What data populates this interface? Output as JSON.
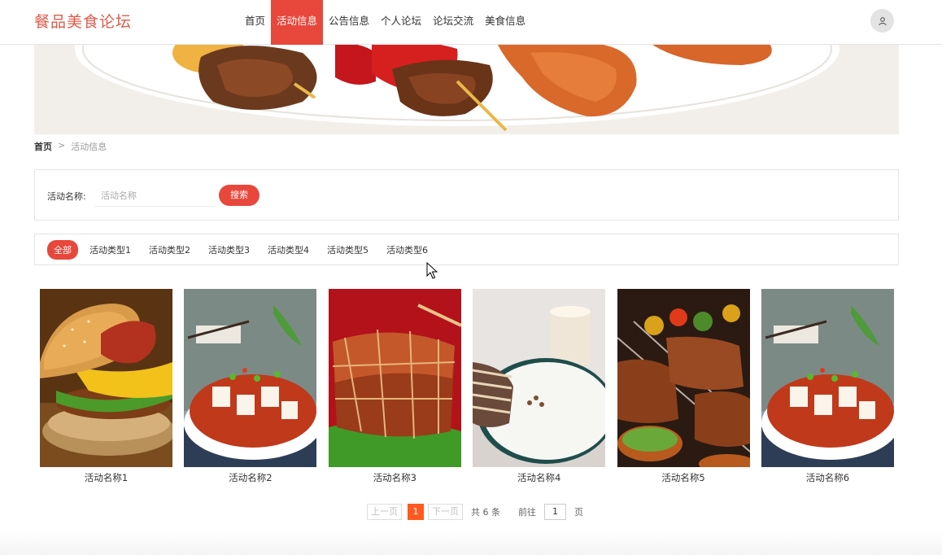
{
  "header": {
    "logo": "餐品美食论坛",
    "nav": [
      {
        "label": "首页",
        "active": false
      },
      {
        "label": "活动信息",
        "active": true
      },
      {
        "label": "公告信息",
        "active": false
      },
      {
        "label": "个人论坛",
        "active": false
      },
      {
        "label": "论坛交流",
        "active": false
      },
      {
        "label": "美食信息",
        "active": false
      }
    ],
    "avatar_icon": "user-icon"
  },
  "breadcrumb": {
    "home": "首页",
    "separator": ">",
    "current": "活动信息"
  },
  "search": {
    "label": "活动名称:",
    "placeholder": "活动名称",
    "value": "",
    "button": "搜索"
  },
  "categories": [
    {
      "label": "全部",
      "active": true
    },
    {
      "label": "活动类型1",
      "active": false
    },
    {
      "label": "活动类型2",
      "active": false
    },
    {
      "label": "活动类型3",
      "active": false
    },
    {
      "label": "活动类型4",
      "active": false
    },
    {
      "label": "活动类型5",
      "active": false
    },
    {
      "label": "活动类型6",
      "active": false
    }
  ],
  "activities": [
    {
      "name": "活动名称1"
    },
    {
      "name": "活动名称2"
    },
    {
      "name": "活动名称3"
    },
    {
      "name": "活动名称4"
    },
    {
      "name": "活动名称5"
    },
    {
      "name": "活动名称6"
    }
  ],
  "pagination": {
    "prev": "上一页",
    "current": "1",
    "next": "下一页",
    "total": "共 6 条",
    "goto_label": "前往",
    "goto_value": "1",
    "page_suffix": "页"
  },
  "colors": {
    "accent": "#e8473b",
    "logo": "#e05a4a",
    "page_active": "#ff5a1f"
  }
}
